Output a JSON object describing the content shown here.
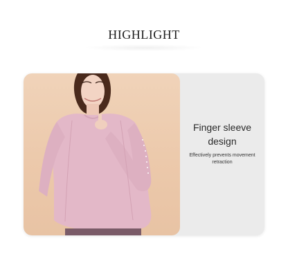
{
  "header": {
    "title": "HIGHLIGHT"
  },
  "feature": {
    "title_line1": "Finger sleeve",
    "title_line2": "design",
    "desc_line1": "Effectively prevents movement",
    "desc_line2": "retraction"
  },
  "colors": {
    "page_background": "#ffffff",
    "card_background": "#ebebeb",
    "photo_background": "#ecc9ab",
    "shirt": "#e3b8c8",
    "text": "#2a2a2a"
  }
}
